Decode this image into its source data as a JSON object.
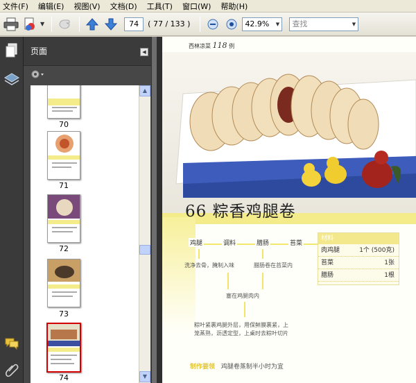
{
  "menu": {
    "items": [
      "文件(F)",
      "编辑(E)",
      "视图(V)",
      "文档(D)",
      "工具(T)",
      "窗口(W)",
      "帮助(H)"
    ]
  },
  "toolbar": {
    "page_number": "74",
    "page_count": "( 77 / 133 )",
    "zoom": "42.9%",
    "search_placeholder": "查找"
  },
  "panel": {
    "title": "页面"
  },
  "thumbnails": [
    {
      "label": "70"
    },
    {
      "label": "71"
    },
    {
      "label": "72"
    },
    {
      "label": "73"
    },
    {
      "label": "74"
    }
  ],
  "document": {
    "header_text": "西林凉菜",
    "header_number": "118",
    "header_suffix": "例",
    "title": "66 粽香鸡腿卷",
    "steps": {
      "s1": "鸡腿",
      "s2": "调料",
      "s3": "腊肠",
      "s4": "苔菜",
      "t1": "洗净去骨，腌制入味",
      "t2": "腊肠卷在苔菜内",
      "t3": "塞在鸡腿肉内",
      "t4a": "粽叶紧裹鸡腿外层，用保鲜膜裹紧，上",
      "t4b": "笼蒸熟，沥透定型，上桌时去粽叶切片"
    },
    "ingredients": {
      "head": "材料",
      "rows": [
        {
          "name": "肉鸡腿",
          "qty": "1个 (500克)"
        },
        {
          "name": "苔菜",
          "qty": "1张"
        },
        {
          "name": "腊肠",
          "qty": "1根"
        }
      ]
    },
    "tip_tag": "制作要领",
    "tip_text": "鸡腿卷蒸制半小时为宜"
  },
  "colors": {
    "selection_border": "#d40000",
    "panel_bg": "#474747",
    "accent_yellow": "#f3e88b"
  }
}
